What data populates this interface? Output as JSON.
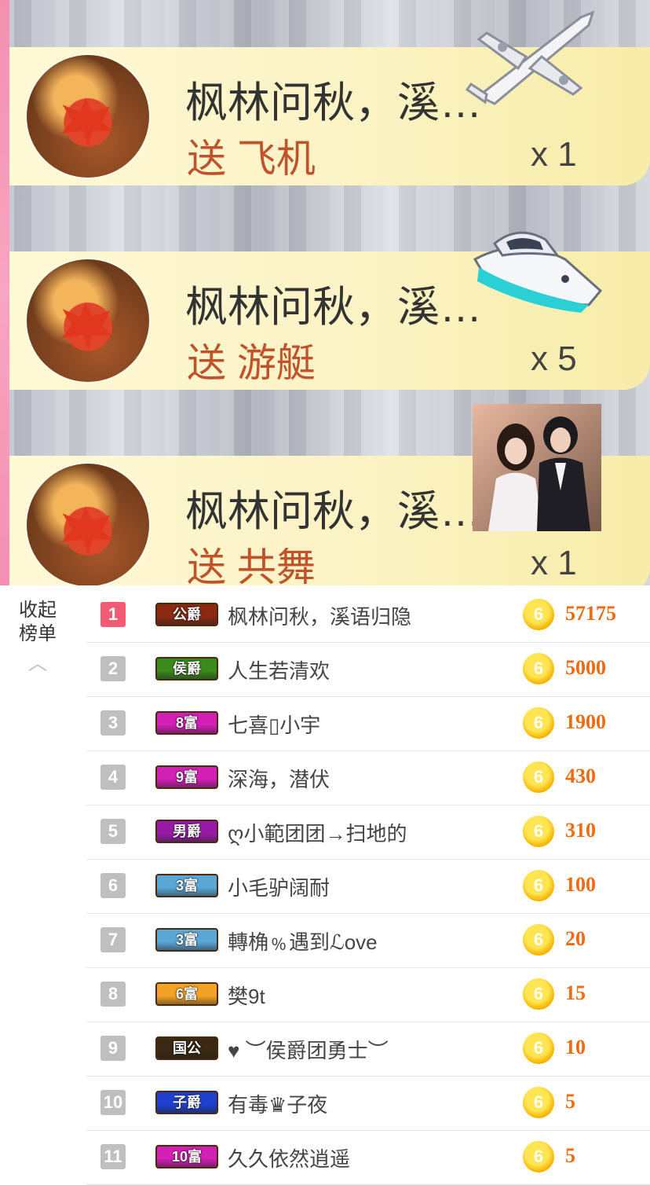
{
  "gift_feed": [
    {
      "sender": "枫林问秋，溪…",
      "action": "送 飞机",
      "count": "x 1",
      "gift_icon": "airplane-icon"
    },
    {
      "sender": "枫林问秋，溪…",
      "action": "送 游艇",
      "count": "x 5",
      "gift_icon": "yacht-icon"
    },
    {
      "sender": "枫林问秋，溪…",
      "action": "送 共舞",
      "count": "x 1",
      "gift_icon": "dance-couple-icon"
    }
  ],
  "collapse": {
    "line1": "收起",
    "line2": "榜单"
  },
  "ranking": [
    {
      "rank": "1",
      "badge": "公爵",
      "badge_color": "#8b2a10",
      "name": "枫林问秋，溪语归隐",
      "coin": "6",
      "amount": "57175"
    },
    {
      "rank": "2",
      "badge": "侯爵",
      "badge_color": "#3a8a1c",
      "name": "人生若清欢",
      "coin": "6",
      "amount": "5000"
    },
    {
      "rank": "3",
      "badge": "8富",
      "badge_color": "#d21fb4",
      "name": "七喜▯小宇",
      "coin": "6",
      "amount": "1900"
    },
    {
      "rank": "4",
      "badge": "9富",
      "badge_color": "#d21fb4",
      "name": "深海，潜伏",
      "coin": "6",
      "amount": "430"
    },
    {
      "rank": "5",
      "badge": "男爵",
      "badge_color": "#9a1aa8",
      "name": "ღ小範团团→扫地的",
      "coin": "6",
      "amount": "310"
    },
    {
      "rank": "6",
      "badge": "3富",
      "badge_color": "#5aa7d6",
      "name": "小毛驴阔耐",
      "coin": "6",
      "amount": "100"
    },
    {
      "rank": "7",
      "badge": "3富",
      "badge_color": "#5aa7d6",
      "name": "轉桷﹪遇到ℒove",
      "coin": "6",
      "amount": "20"
    },
    {
      "rank": "8",
      "badge": "6富",
      "badge_color": "#f2a225",
      "name": "樊9t",
      "coin": "6",
      "amount": "15"
    },
    {
      "rank": "9",
      "badge": "国公",
      "badge_color": "#3a2812",
      "name": "♥ ︶侯爵团勇士︶",
      "coin": "6",
      "amount": "10"
    },
    {
      "rank": "10",
      "badge": "子爵",
      "badge_color": "#1f3fcf",
      "name": "有毒♛子夜",
      "coin": "6",
      "amount": "5"
    },
    {
      "rank": "11",
      "badge": "10富",
      "badge_color": "#d21fb4",
      "name": "久久依然逍遥",
      "coin": "6",
      "amount": "5"
    }
  ]
}
